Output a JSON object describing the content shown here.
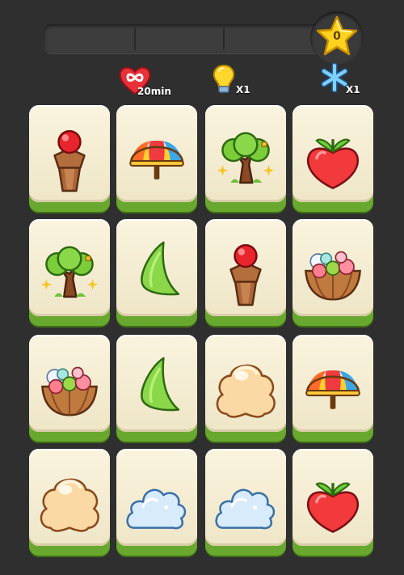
{
  "hud": {
    "progress_fraction": 0,
    "star_count": "0",
    "powerups": [
      {
        "icon": "heart-infinity-icon",
        "label": "20min"
      },
      {
        "icon": "lightbulb-icon",
        "label": "X1"
      },
      {
        "icon": "snowflake-icon",
        "label": "X1"
      }
    ]
  },
  "board": {
    "rows": 4,
    "cols": 4,
    "tiles": [
      "lollipop-stand",
      "beach-umbrella",
      "tree",
      "strawberry",
      "tree",
      "leaf",
      "lollipop-stand",
      "flower-basket",
      "flower-basket",
      "leaf",
      "cream-puff",
      "beach-umbrella",
      "cream-puff",
      "cloud",
      "cloud",
      "strawberry"
    ]
  },
  "colors": {
    "background": "#2f2f2f",
    "tile_face": "#f5edd3",
    "tile_base": "#69a82e",
    "star": "#ffd21f"
  }
}
